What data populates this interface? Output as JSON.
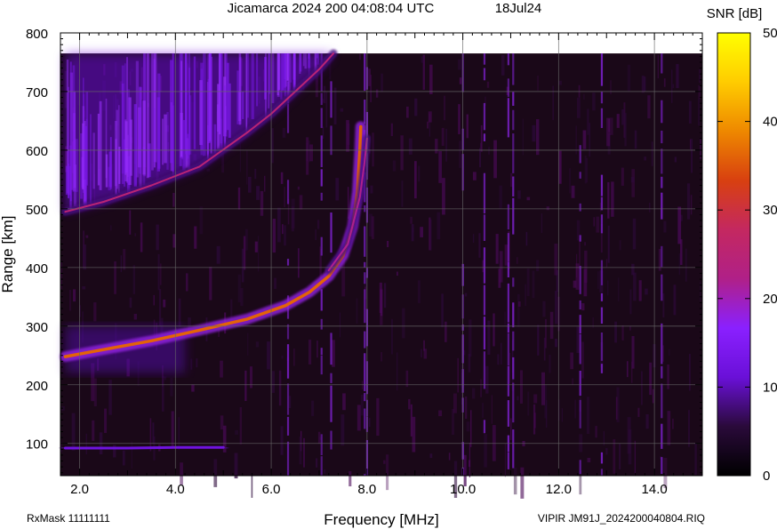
{
  "header": {
    "title": "Jicamarca 2024 200 04:08:04 UTC",
    "date": "18Jul24"
  },
  "footer": {
    "rx_mask": "RxMask 11111111",
    "file_label": "VIPIR  JM91J_2024200040804.RIQ"
  },
  "chart_data": {
    "type": "heatmap",
    "title": "Jicamarca 2024 200 04:08:04 UTC",
    "xlabel": "Frequency [MHz]",
    "ylabel": "Range [km]",
    "xlim": [
      1.6,
      15.0
    ],
    "ylim": [
      45,
      800
    ],
    "data_top_range_km": 765,
    "x_ticks": [
      2,
      4,
      6,
      8,
      10,
      12,
      14
    ],
    "x_tick_labels": [
      "2.0",
      "4.0",
      "6.0",
      "8.0",
      "10.0",
      "12.0",
      "14.0"
    ],
    "y_ticks": [
      100,
      200,
      300,
      400,
      500,
      600,
      700,
      800
    ],
    "y_tick_labels": [
      "100",
      "200",
      "300",
      "400",
      "500",
      "600",
      "700",
      "800"
    ],
    "grid": true,
    "colorbar": {
      "label": "SNR [dB]",
      "range": [
        0,
        50
      ],
      "ticks": [
        0,
        10,
        20,
        30,
        40,
        50
      ],
      "tick_labels": [
        "0",
        "10",
        "20",
        "30",
        "40",
        "50"
      ],
      "colormap": [
        "#000000",
        "#2a0a3a",
        "#6a10d8",
        "#8a20ff",
        "#b02088",
        "#c42860",
        "#d84010",
        "#ee8800",
        "#ffcc00",
        "#ffff00"
      ]
    },
    "traces": [
      {
        "name": "E-layer echo",
        "points": [
          [
            1.7,
            92
          ],
          [
            3.0,
            92
          ],
          [
            4.0,
            93
          ],
          [
            5.0,
            93
          ]
        ],
        "snr_db": 12
      },
      {
        "name": "F-layer O-mode echo",
        "points": [
          [
            1.7,
            248
          ],
          [
            2.5,
            260
          ],
          [
            3.5,
            275
          ],
          [
            4.5,
            293
          ],
          [
            5.5,
            312
          ],
          [
            6.3,
            335
          ],
          [
            6.8,
            358
          ],
          [
            7.2,
            385
          ],
          [
            7.5,
            420
          ],
          [
            7.7,
            470
          ],
          [
            7.8,
            530
          ],
          [
            7.85,
            600
          ],
          [
            7.87,
            640
          ]
        ],
        "snr_db": 36
      },
      {
        "name": "F-layer X-mode echo",
        "points": [
          [
            7.2,
            395
          ],
          [
            7.6,
            440
          ],
          [
            7.85,
            520
          ],
          [
            7.95,
            580
          ],
          [
            8.0,
            620
          ]
        ],
        "snr_db": 22
      },
      {
        "name": "second-hop echo",
        "points": [
          [
            1.7,
            495
          ],
          [
            2.5,
            512
          ],
          [
            3.5,
            540
          ],
          [
            4.5,
            572
          ],
          [
            5.5,
            630
          ],
          [
            6.0,
            662
          ],
          [
            6.5,
            700
          ],
          [
            7.0,
            738
          ],
          [
            7.3,
            765
          ]
        ],
        "snr_db": 25
      }
    ],
    "interference_lines_mhz": [
      6.35,
      7.05,
      7.25,
      7.95,
      8.0,
      10.0,
      10.45,
      10.95,
      11.05,
      12.45,
      12.9,
      14.15
    ]
  }
}
